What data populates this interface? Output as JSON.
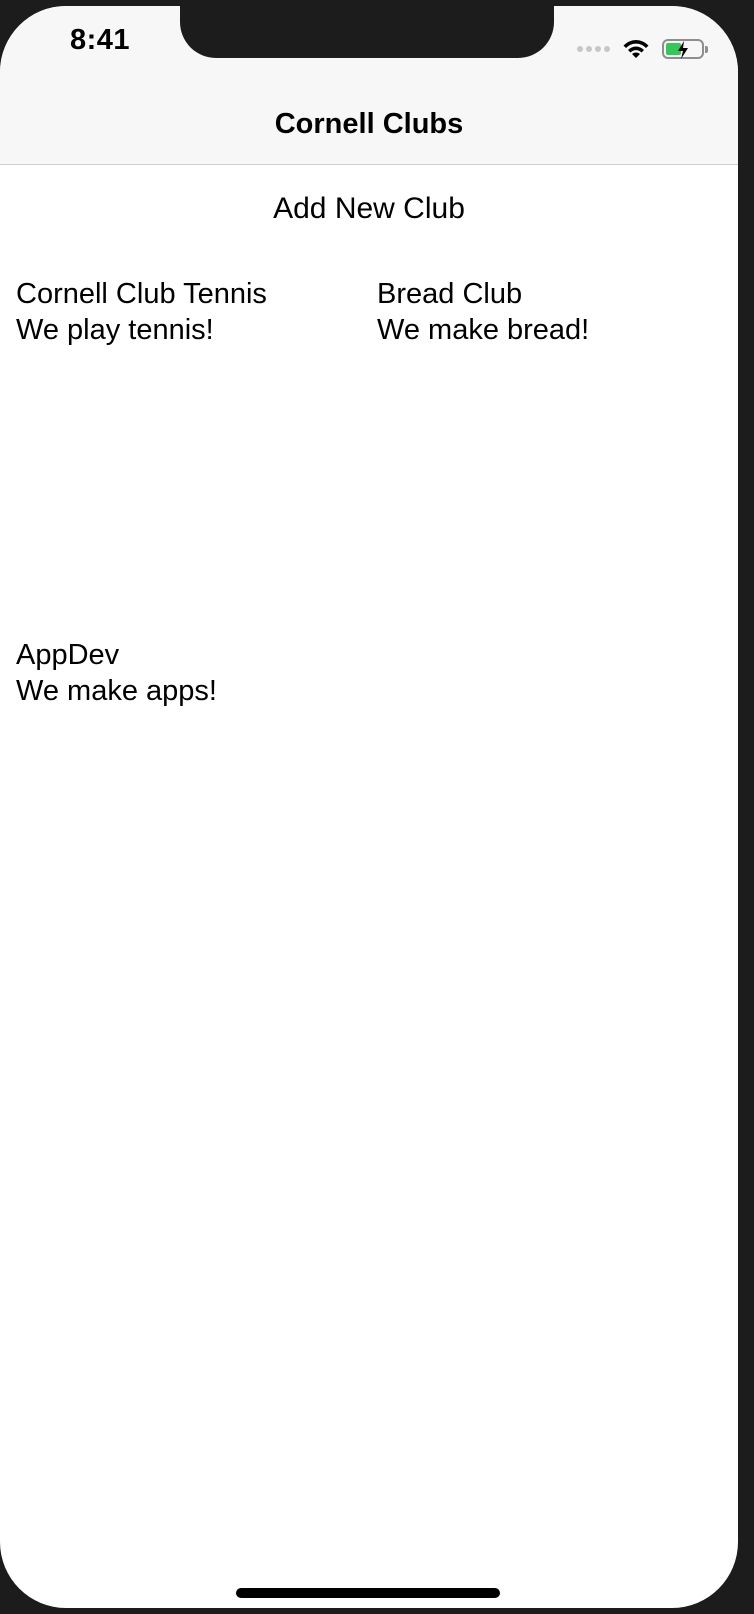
{
  "status_bar": {
    "time": "8:41",
    "icons": [
      "signal-icon",
      "wifi-icon",
      "battery-charging-icon"
    ],
    "battery_level": 0.45,
    "battery_color": "#34c759"
  },
  "nav": {
    "title": "Cornell Clubs"
  },
  "actions": {
    "add_label": "Add New Club"
  },
  "clubs": [
    {
      "name": "Cornell Club Tennis",
      "description": "We play tennis!"
    },
    {
      "name": "Bread Club",
      "description": "We make bread!"
    },
    {
      "name": "AppDev",
      "description": "We make apps!"
    }
  ]
}
